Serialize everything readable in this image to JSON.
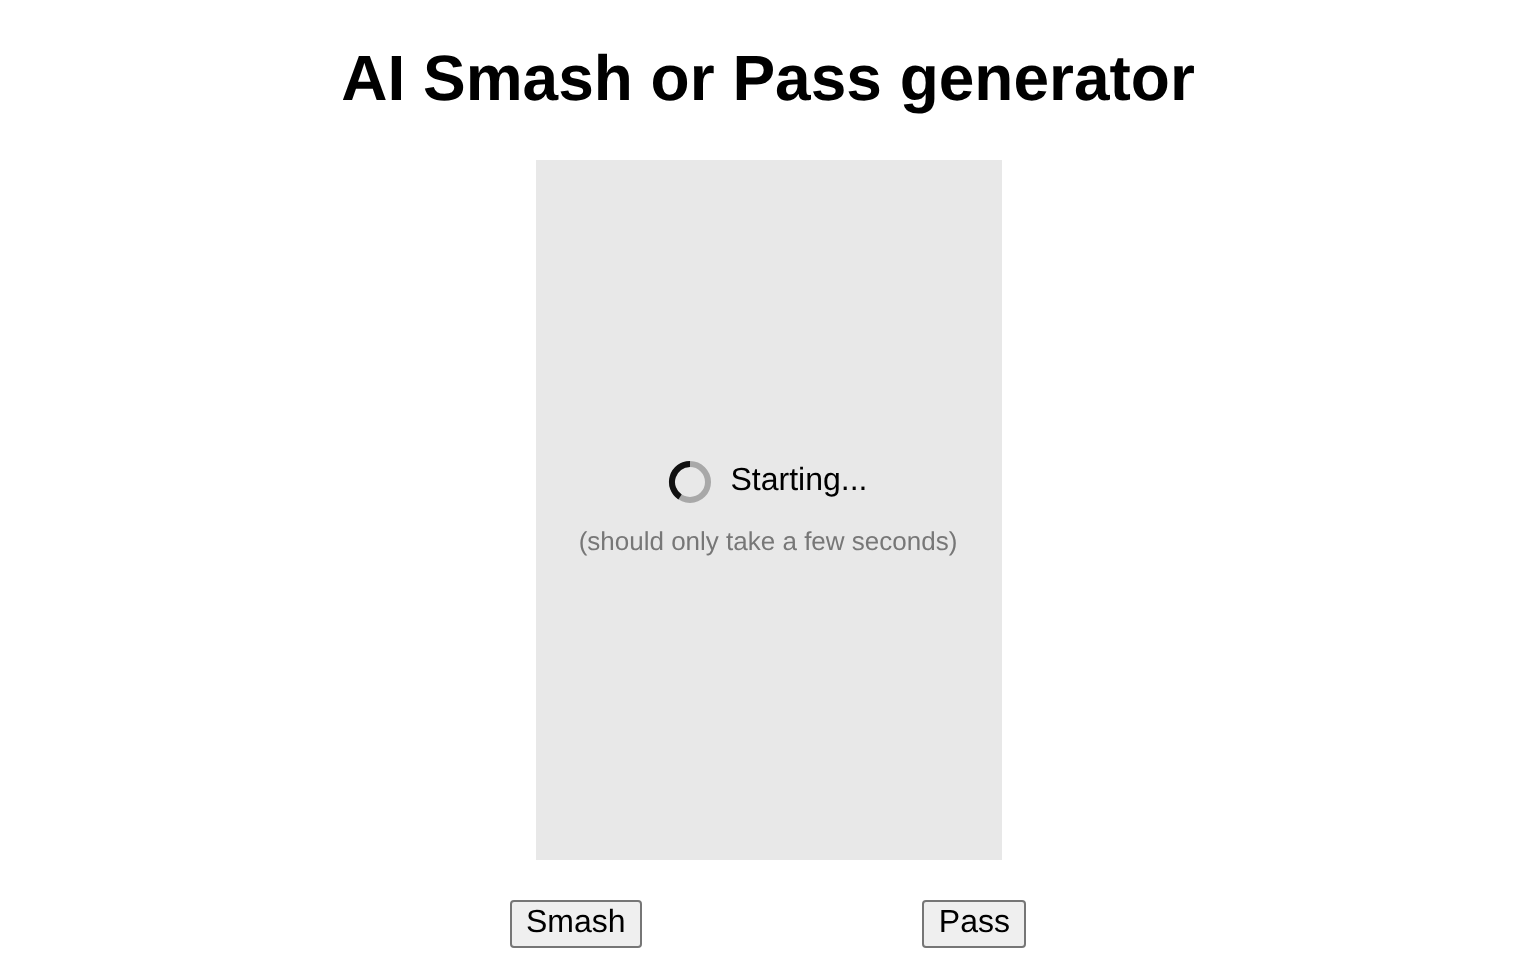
{
  "title": "AI Smash or Pass generator",
  "status": {
    "label": "Starting...",
    "hint": "(should only take a few seconds)"
  },
  "buttons": [
    "Smash",
    "Pass"
  ]
}
